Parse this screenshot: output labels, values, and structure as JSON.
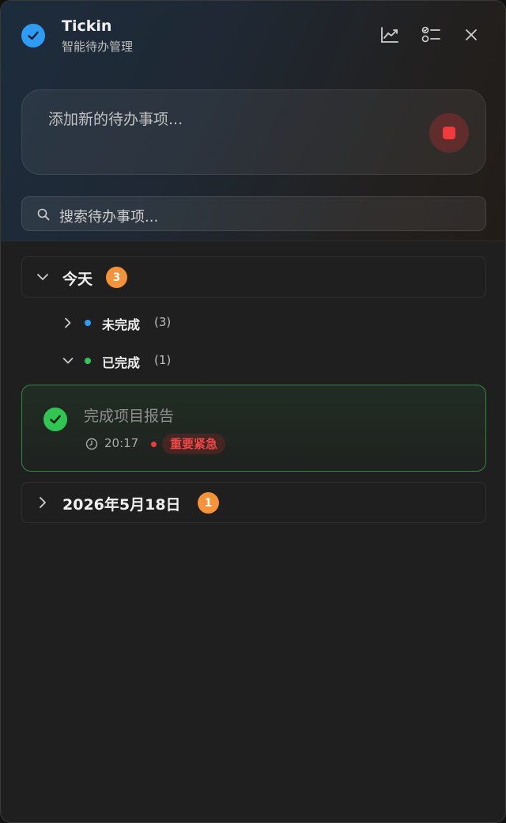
{
  "app": {
    "title": "Tickin",
    "subtitle": "智能待办管理"
  },
  "toolbar": {
    "stats_icon": "chart-line-icon",
    "list_icon": "checklist-icon",
    "close_icon": "close-icon"
  },
  "add_input": {
    "placeholder": "添加新的待办事项..."
  },
  "search": {
    "placeholder": "搜索待办事项..."
  },
  "groups": [
    {
      "title": "今天",
      "count": "3",
      "expanded": true,
      "subgroups": [
        {
          "label": "未完成",
          "count": "(3)",
          "dot_color": "#2e9cf4",
          "expanded": false
        },
        {
          "label": "已完成",
          "count": "(1)",
          "dot_color": "#31c653",
          "expanded": true
        }
      ],
      "tasks": [
        {
          "title": "完成项目报告",
          "time": "20:17",
          "priority": "重要紧急",
          "completed": true
        }
      ]
    },
    {
      "title": "2026年5月18日",
      "count": "1",
      "expanded": false
    }
  ],
  "colors": {
    "accent_blue": "#2e9cf4",
    "badge_orange": "#f5923a",
    "done_green": "#31c653",
    "urgent_red": "#ef3b3b"
  }
}
